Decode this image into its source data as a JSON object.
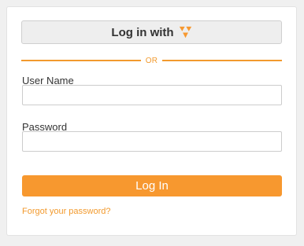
{
  "sso": {
    "label": "Log in with",
    "logo_icon": "orange-triangle-logo-icon",
    "logo_color": "#f7982f"
  },
  "divider": {
    "text": "OR",
    "color": "#f29a2e"
  },
  "form": {
    "username_label": "User Name",
    "username_value": "",
    "password_label": "Password",
    "password_value": ""
  },
  "login_button": {
    "label": "Log In",
    "color": "#f7982f"
  },
  "forgot_password": {
    "label": "Forgot your password?"
  }
}
